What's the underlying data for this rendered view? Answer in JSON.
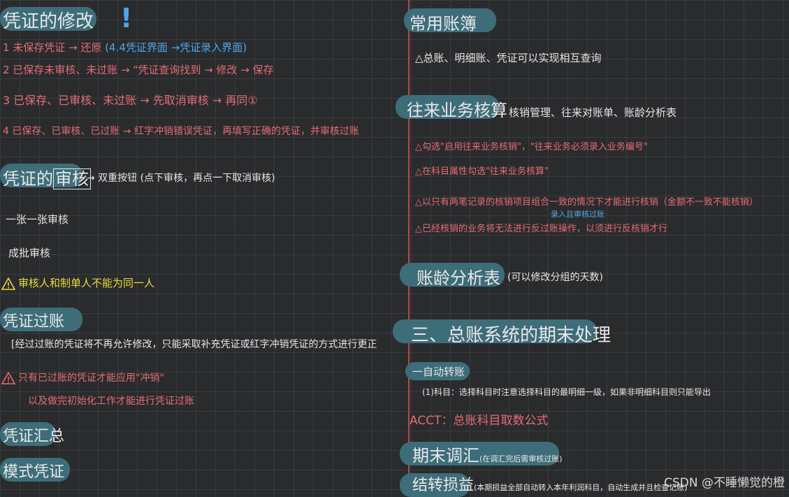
{
  "left": {
    "section1": {
      "title": "凭证的修改",
      "items": [
        {
          "text": "1 未保存凭证 → 还原",
          "note": "(4.4凭证界面 →凭证录入界面)"
        },
        {
          "text": "2 已保存未审核、未过账 → \"凭证查询找到 → 修改 → 保存"
        },
        {
          "text": "3 已保存、已审核、未过账 → 先取消审核 → 再同①"
        },
        {
          "text": "4 已保存、已审核、已过账 → 红字冲销错误凭证，再填写正确的凭证，并审核过账"
        }
      ]
    },
    "section2": {
      "title_pre": "凭证的",
      "title_box": "审核",
      "arrow_text": "→ 双重按钮 (点下审核，再点一下取消审核)",
      "line1": "一张一张审核",
      "line2": "成批审核",
      "warning": "审核人和制单人不能为同一人"
    },
    "section3": {
      "title": "凭证过账",
      "desc": "[经过过账的凭证将不再允许修改，只能采取补充凭证或红字冲销凭证的方式进行更正",
      "warning_l1": "只有已过账的凭证才能应用\"冲销\"",
      "warning_l2": "以及做完初始化工作才能进行凭证过账"
    },
    "section4": {
      "title": "凭证汇总"
    },
    "section5": {
      "title": "模式凭证"
    },
    "pen_mark": "!"
  },
  "right": {
    "section1": {
      "title": "常用账簿",
      "desc": "△总账、明细账、凭证可以实现相互查询"
    },
    "section2": {
      "title": "往来业务核算",
      "subtitle": "核销管理、往来对账单、账龄分析表",
      "items": [
        "△勾选\"启用往来业务核销\"，\"往来业务必须录入业务编号\"",
        "△在科目属性勾选\"往来业务核算\"",
        "△以只有两笔记录的核销项目组合一致的情况下才能进行核销（金额不一致不能核销）",
        "△已经核销的业务将无法进行反过账操作，以须进行反核销才行"
      ],
      "blue_note": "录入且审核过账"
    },
    "section3": {
      "title": "账龄分析表",
      "note": "(可以修改分组的天数)"
    },
    "section4": {
      "title": "三、总账系统的期末处理"
    },
    "section5": {
      "title": "一自动转账",
      "line1": "(1)科目：选择科目时注意选择科目的最明细一级，如果非明细科目则只能导出",
      "line2": "ACCT：总账科目取数公式"
    },
    "section6": {
      "title": "期末调汇",
      "note": "(在调汇完后需审核过账)"
    },
    "section7": {
      "title": "结转损益",
      "note": "(本期损益全部自动转入本年利润科目，自动生成并且检查记账)"
    }
  },
  "watermark": "CSDN @不睡懒觉的橙"
}
